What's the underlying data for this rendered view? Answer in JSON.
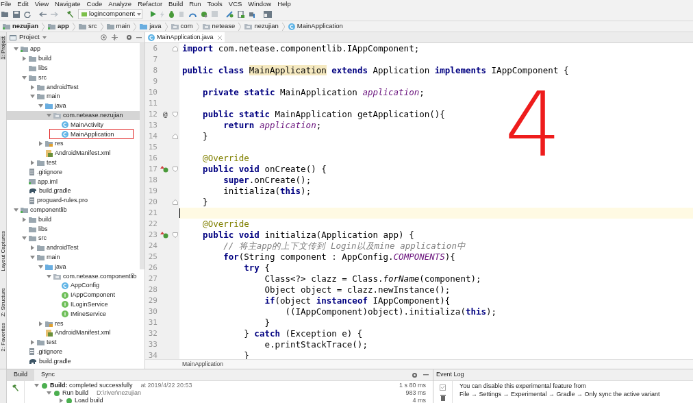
{
  "menu_bar": [
    "File",
    "Edit",
    "View",
    "Navigate",
    "Code",
    "Analyze",
    "Refactor",
    "Build",
    "Run",
    "Tools",
    "VCS",
    "Window",
    "Help"
  ],
  "toolbar": {
    "run_config": "logincomponent"
  },
  "breadcrumbs": [
    {
      "label": "nezujian",
      "kind": "module"
    },
    {
      "label": "app",
      "kind": "module"
    },
    {
      "label": "src",
      "kind": "folder"
    },
    {
      "label": "main",
      "kind": "folder"
    },
    {
      "label": "java",
      "kind": "source"
    },
    {
      "label": "com",
      "kind": "package"
    },
    {
      "label": "netease",
      "kind": "package"
    },
    {
      "label": "nezujian",
      "kind": "package"
    },
    {
      "label": "MainApplication",
      "kind": "class"
    }
  ],
  "left_stripe": [
    {
      "label": "1: Project",
      "selected": true
    },
    {
      "label": "Layout Captures",
      "selected": false
    },
    {
      "label": "Z: Structure",
      "selected": false
    },
    {
      "label": "2: Favorites",
      "selected": false
    }
  ],
  "project_panel": {
    "title": "Project",
    "tree": [
      {
        "label": "app",
        "kind": "module",
        "expanded": true,
        "selected": false,
        "children": [
          {
            "label": "build",
            "kind": "folder",
            "expanded": false,
            "selected": false
          },
          {
            "label": "libs",
            "kind": "folder",
            "selected": false
          },
          {
            "label": "src",
            "kind": "folder",
            "expanded": true,
            "selected": false,
            "children": [
              {
                "label": "androidTest",
                "kind": "folder",
                "expanded": false,
                "selected": false
              },
              {
                "label": "main",
                "kind": "folder",
                "expanded": true,
                "selected": false,
                "children": [
                  {
                    "label": "java",
                    "kind": "source",
                    "expanded": true,
                    "selected": false,
                    "children": [
                      {
                        "label": "com.netease.nezujian",
                        "kind": "package",
                        "expanded": true,
                        "selected": true,
                        "children": [
                          {
                            "label": "MainActivity",
                            "kind": "class",
                            "selected": false
                          },
                          {
                            "label": "MainApplication",
                            "kind": "class",
                            "selected": false,
                            "annotated": true
                          }
                        ]
                      }
                    ]
                  },
                  {
                    "label": "res",
                    "kind": "res",
                    "expanded": false,
                    "selected": false
                  },
                  {
                    "label": "AndroidManifest.xml",
                    "kind": "manifest",
                    "selected": false
                  }
                ]
              },
              {
                "label": "test",
                "kind": "folder",
                "expanded": false,
                "selected": false
              }
            ]
          },
          {
            "label": ".gitignore",
            "kind": "file",
            "selected": false
          },
          {
            "label": "app.iml",
            "kind": "iml",
            "selected": false
          },
          {
            "label": "build.gradle",
            "kind": "gradle",
            "selected": false
          },
          {
            "label": "proguard-rules.pro",
            "kind": "file",
            "selected": false
          }
        ]
      },
      {
        "label": "componentlib",
        "kind": "module",
        "expanded": true,
        "selected": false,
        "children": [
          {
            "label": "build",
            "kind": "folder",
            "expanded": false,
            "selected": false
          },
          {
            "label": "libs",
            "kind": "folder",
            "selected": false
          },
          {
            "label": "src",
            "kind": "folder",
            "expanded": true,
            "selected": false,
            "children": [
              {
                "label": "androidTest",
                "kind": "folder",
                "expanded": false,
                "selected": false
              },
              {
                "label": "main",
                "kind": "folder",
                "expanded": true,
                "selected": false,
                "children": [
                  {
                    "label": "java",
                    "kind": "source",
                    "expanded": true,
                    "selected": false,
                    "children": [
                      {
                        "label": "com.netease.componentlib",
                        "kind": "package",
                        "expanded": true,
                        "selected": false,
                        "children": [
                          {
                            "label": "AppConfig",
                            "kind": "class",
                            "selected": false
                          },
                          {
                            "label": "IAppComponent",
                            "kind": "interface",
                            "selected": false
                          },
                          {
                            "label": "ILoginService",
                            "kind": "interface",
                            "selected": false
                          },
                          {
                            "label": "IMineService",
                            "kind": "interface",
                            "selected": false
                          }
                        ]
                      }
                    ]
                  },
                  {
                    "label": "res",
                    "kind": "res",
                    "expanded": false,
                    "selected": false
                  },
                  {
                    "label": "AndroidManifest.xml",
                    "kind": "manifest",
                    "selected": false
                  }
                ]
              },
              {
                "label": "test",
                "kind": "folder",
                "expanded": false,
                "selected": false
              }
            ]
          },
          {
            "label": ".gitignore",
            "kind": "file",
            "selected": false
          },
          {
            "label": "build.gradle",
            "kind": "gradle",
            "selected": false
          }
        ]
      }
    ]
  },
  "editor": {
    "tabs": [
      {
        "label": "MainApplication.java",
        "selected": true
      }
    ],
    "lines": [
      {
        "number": "6",
        "fold_end": true,
        "tokens": [
          {
            "kind": "keyword",
            "text": "import"
          },
          {
            "kind": "plain",
            "text": " com.netease.componentlib.IAppComponent;"
          }
        ]
      },
      {
        "number": "7"
      },
      {
        "number": "8",
        "tokens": [
          {
            "kind": "keyword",
            "text": "public class "
          },
          {
            "kind": "highlight",
            "text": "MainApplication"
          },
          {
            "kind": "keyword",
            "text": " extends "
          },
          {
            "kind": "plain",
            "text": "Application "
          },
          {
            "kind": "keyword",
            "text": "implements "
          },
          {
            "kind": "plain",
            "text": "IAppComponent {"
          }
        ]
      },
      {
        "number": "9"
      },
      {
        "number": "10",
        "tokens": [
          {
            "kind": "keyword",
            "text": "    private static "
          },
          {
            "kind": "plain",
            "text": "MainApplication "
          },
          {
            "kind": "field",
            "text": "application"
          },
          {
            "kind": "plain",
            "text": ";"
          }
        ]
      },
      {
        "number": "11"
      },
      {
        "number": "12",
        "marker": "@",
        "fold_start": true,
        "tokens": [
          {
            "kind": "keyword",
            "text": "    public static "
          },
          {
            "kind": "plain",
            "text": "MainApplication getApplication(){"
          }
        ]
      },
      {
        "number": "13",
        "tokens": [
          {
            "kind": "keyword",
            "text": "        return "
          },
          {
            "kind": "field",
            "text": "application"
          },
          {
            "kind": "plain",
            "text": ";"
          }
        ]
      },
      {
        "number": "14",
        "fold_end": true,
        "tokens": [
          {
            "kind": "plain",
            "text": "    }"
          }
        ]
      },
      {
        "number": "15"
      },
      {
        "number": "16",
        "tokens": [
          {
            "kind": "annotation",
            "text": "    @Override"
          }
        ]
      },
      {
        "number": "17",
        "overrides": true,
        "fold_start": true,
        "tokens": [
          {
            "kind": "keyword",
            "text": "    public void "
          },
          {
            "kind": "plain",
            "text": "onCreate() {"
          }
        ]
      },
      {
        "number": "18",
        "tokens": [
          {
            "kind": "keyword",
            "text": "        super"
          },
          {
            "kind": "plain",
            "text": ".onCreate();"
          }
        ]
      },
      {
        "number": "19",
        "tokens": [
          {
            "kind": "plain",
            "text": "        initializa("
          },
          {
            "kind": "keyword",
            "text": "this"
          },
          {
            "kind": "plain",
            "text": ");"
          }
        ]
      },
      {
        "number": "20",
        "fold_end": true,
        "tokens": [
          {
            "kind": "plain",
            "text": "    }"
          }
        ]
      },
      {
        "number": "21",
        "current": true
      },
      {
        "number": "22",
        "tokens": [
          {
            "kind": "annotation",
            "text": "    @Override"
          }
        ]
      },
      {
        "number": "23",
        "overrides": true,
        "fold_start": true,
        "tokens": [
          {
            "kind": "keyword",
            "text": "    public void "
          },
          {
            "kind": "plain",
            "text": "initializa(Application app) {"
          }
        ]
      },
      {
        "number": "24",
        "tokens": [
          {
            "kind": "comment",
            "text": "        // 将主app的上下文传到 Login以及mine application中"
          }
        ]
      },
      {
        "number": "25",
        "tokens": [
          {
            "kind": "keyword",
            "text": "        for"
          },
          {
            "kind": "plain",
            "text": "(String component : AppConfig."
          },
          {
            "kind": "field",
            "text": "COMPONENTS"
          },
          {
            "kind": "plain",
            "text": "){"
          }
        ]
      },
      {
        "number": "26",
        "tokens": [
          {
            "kind": "keyword",
            "text": "            try "
          },
          {
            "kind": "plain",
            "text": "{"
          }
        ]
      },
      {
        "number": "27",
        "tokens": [
          {
            "kind": "plain",
            "text": "                Class<?> clazz = Class."
          },
          {
            "kind": "static_call",
            "text": "forName"
          },
          {
            "kind": "plain",
            "text": "(component);"
          }
        ]
      },
      {
        "number": "28",
        "tokens": [
          {
            "kind": "plain",
            "text": "                Object object = clazz.newInstance();"
          }
        ]
      },
      {
        "number": "29",
        "tokens": [
          {
            "kind": "keyword",
            "text": "                if"
          },
          {
            "kind": "plain",
            "text": "(object "
          },
          {
            "kind": "keyword",
            "text": "instanceof "
          },
          {
            "kind": "plain",
            "text": "IAppComponent){"
          }
        ]
      },
      {
        "number": "30",
        "tokens": [
          {
            "kind": "plain",
            "text": "                    ((IAppComponent)object).initializa("
          },
          {
            "kind": "keyword",
            "text": "this"
          },
          {
            "kind": "plain",
            "text": ");"
          }
        ]
      },
      {
        "number": "31",
        "tokens": [
          {
            "kind": "plain",
            "text": "                }"
          }
        ]
      },
      {
        "number": "32",
        "tokens": [
          {
            "kind": "plain",
            "text": "            } "
          },
          {
            "kind": "keyword",
            "text": "catch "
          },
          {
            "kind": "plain",
            "text": "(Exception e) {"
          }
        ]
      },
      {
        "number": "33",
        "tokens": [
          {
            "kind": "plain",
            "text": "                e.printStackTrace();"
          }
        ]
      },
      {
        "number": "34",
        "tokens": [
          {
            "kind": "plain",
            "text": "            }"
          }
        ]
      }
    ],
    "breadcrumb": "MainApplication"
  },
  "annotation": {
    "text": "4"
  },
  "build_panel": {
    "tabs": [
      {
        "label": "Build",
        "selected": true
      },
      {
        "label": "Sync",
        "selected": false
      }
    ],
    "rows": [
      {
        "title": "**Build:** completed successfully",
        "detail": "at 2019/4/22 20:53",
        "time": "1 s 80 ms",
        "children": [
          {
            "title": "Run build",
            "detail": "D:\\river\\nezujian",
            "time": "983 ms",
            "children": [
              {
                "title": "Load build",
                "time": "4 ms"
              }
            ]
          }
        ]
      }
    ]
  },
  "event_log": {
    "title": "Event Log",
    "lines": [
      "You can disable this experimental feature from",
      "File → Settings → Experimental → Gradle → Only sync the active variant"
    ]
  }
}
